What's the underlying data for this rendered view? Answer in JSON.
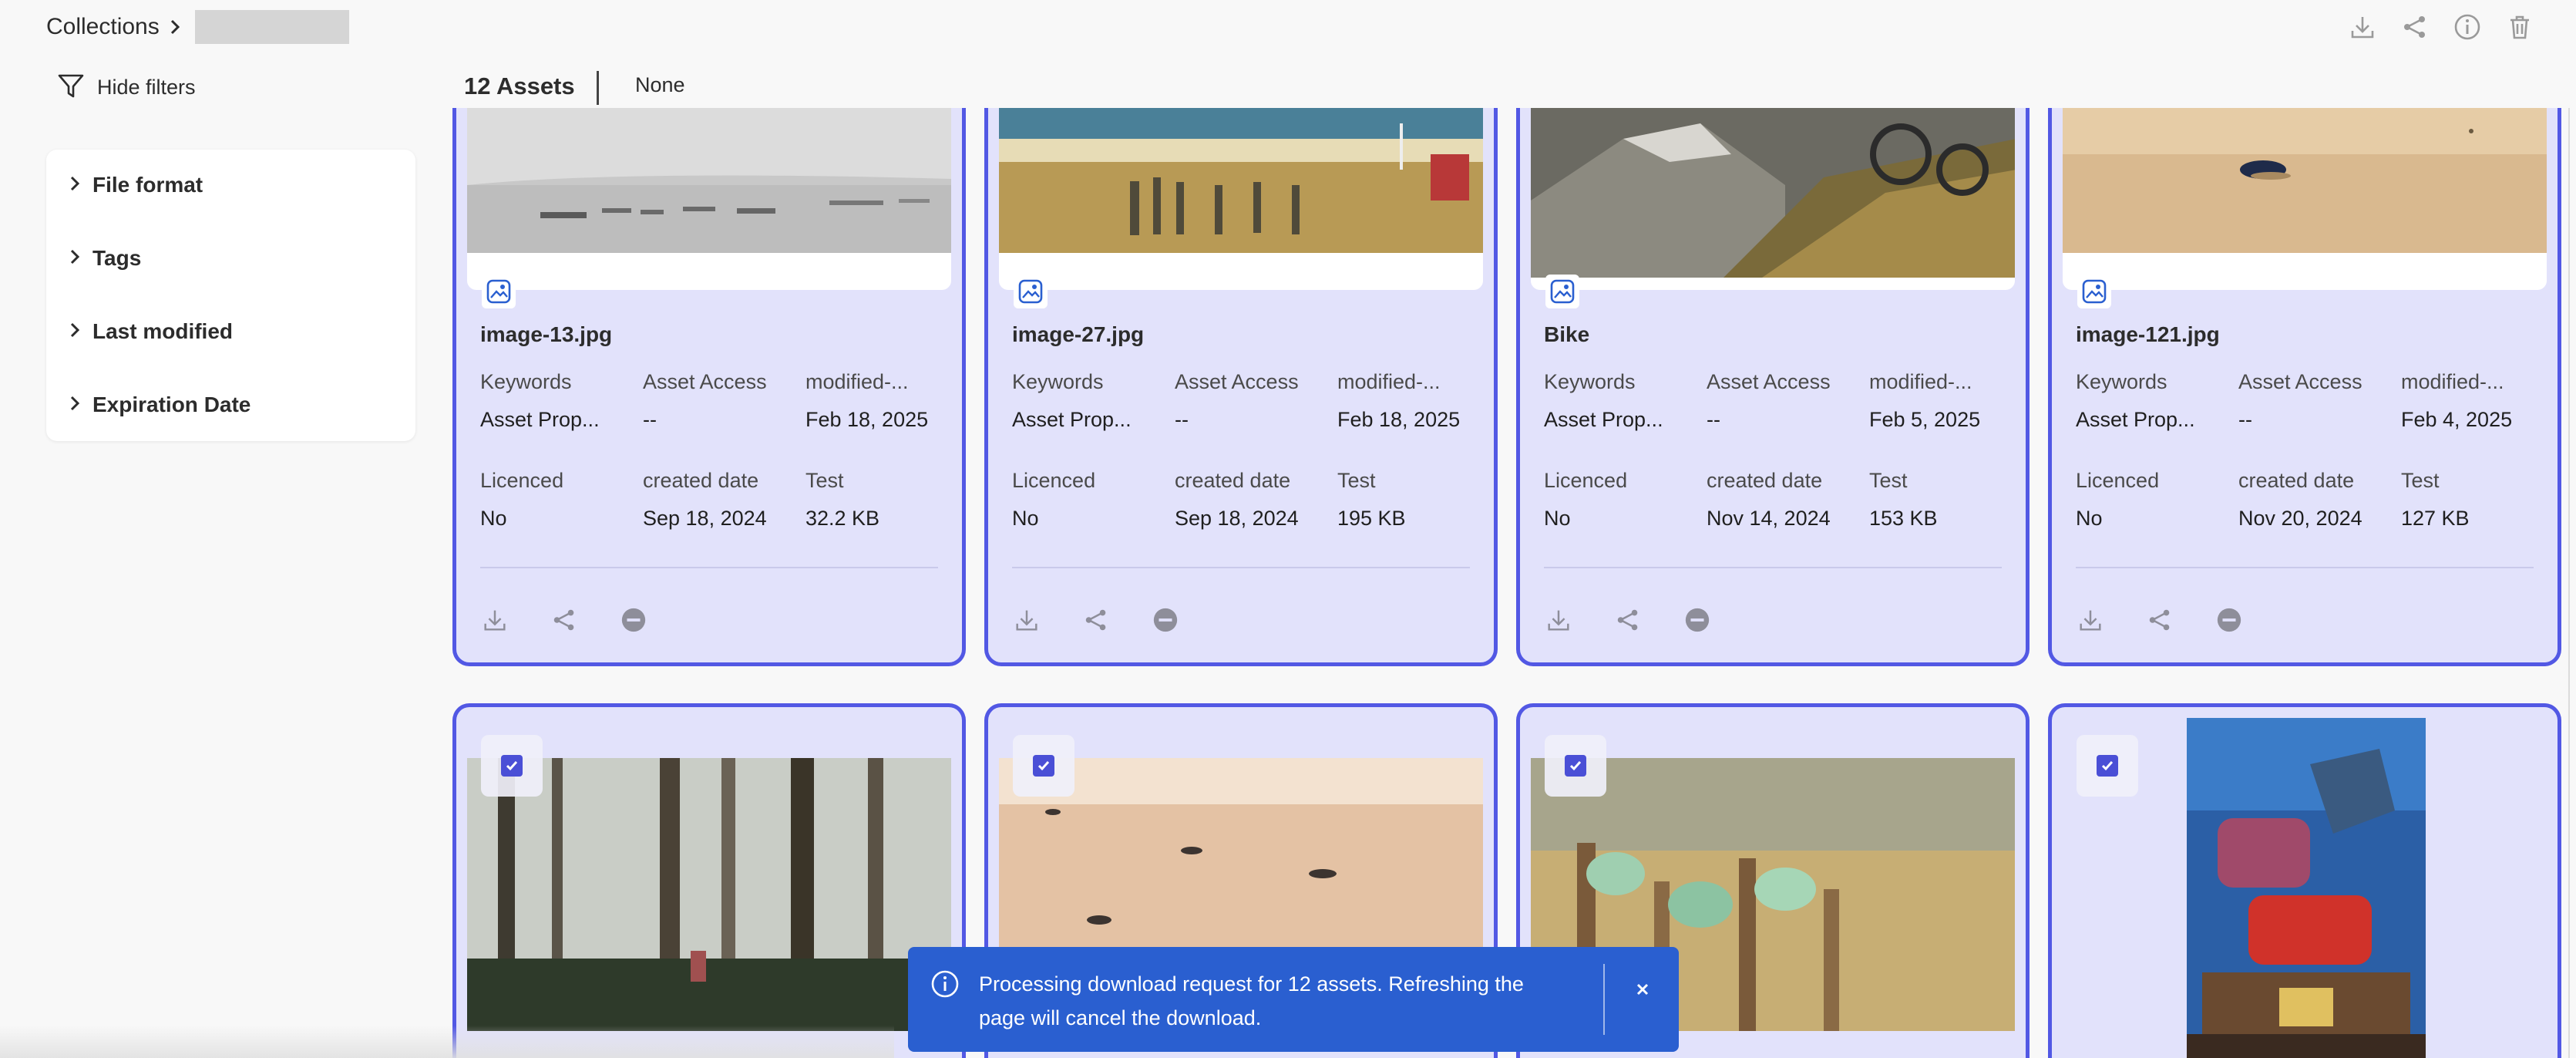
{
  "header": {
    "breadcrumb_root": "Collections",
    "assets_count": "12 Assets",
    "selection_label": "None",
    "hide_filters_label": "Hide filters",
    "actions": [
      "download-icon",
      "share-icon",
      "info-icon",
      "delete-icon"
    ]
  },
  "filters": [
    {
      "label": "File format"
    },
    {
      "label": "Tags"
    },
    {
      "label": "Last modified"
    },
    {
      "label": "Expiration Date"
    }
  ],
  "assets_row1": [
    {
      "title": "image-13.jpg",
      "keywords_label": "Keywords",
      "keywords": "Asset Prop...",
      "access_label": "Asset Access",
      "access": "--",
      "modified_label": "modified-...",
      "modified": "Feb 18, 2025",
      "licenced_label": "Licenced",
      "licenced": "No",
      "created_label": "created date",
      "created": "Sep 18, 2024",
      "test_label": "Test",
      "test": "32.2 KB"
    },
    {
      "title": "image-27.jpg",
      "keywords_label": "Keywords",
      "keywords": "Asset Prop...",
      "access_label": "Asset Access",
      "access": "--",
      "modified_label": "modified-...",
      "modified": "Feb 18, 2025",
      "licenced_label": "Licenced",
      "licenced": "No",
      "created_label": "created date",
      "created": "Sep 18, 2024",
      "test_label": "Test",
      "test": "195 KB"
    },
    {
      "title": "Bike",
      "keywords_label": "Keywords",
      "keywords": "Asset Prop...",
      "access_label": "Asset Access",
      "access": "--",
      "modified_label": "modified-...",
      "modified": "Feb 5, 2025",
      "licenced_label": "Licenced",
      "licenced": "No",
      "created_label": "created date",
      "created": "Nov 14, 2024",
      "test_label": "Test",
      "test": "153 KB"
    },
    {
      "title": "image-121.jpg",
      "keywords_label": "Keywords",
      "keywords": "Asset Prop...",
      "access_label": "Asset Access",
      "access": "--",
      "modified_label": "modified-...",
      "modified": "Feb 4, 2025",
      "licenced_label": "Licenced",
      "licenced": "No",
      "created_label": "created date",
      "created": "Nov 20, 2024",
      "test_label": "Test",
      "test": "127 KB"
    }
  ],
  "toast": {
    "message": "Processing download request for 12 assets. Refreshing the page will cancel the download."
  },
  "colors": {
    "selected_border": "#5258e4",
    "selected_bg": "#e2e2fb",
    "toast_bg": "#2a5fd0"
  }
}
